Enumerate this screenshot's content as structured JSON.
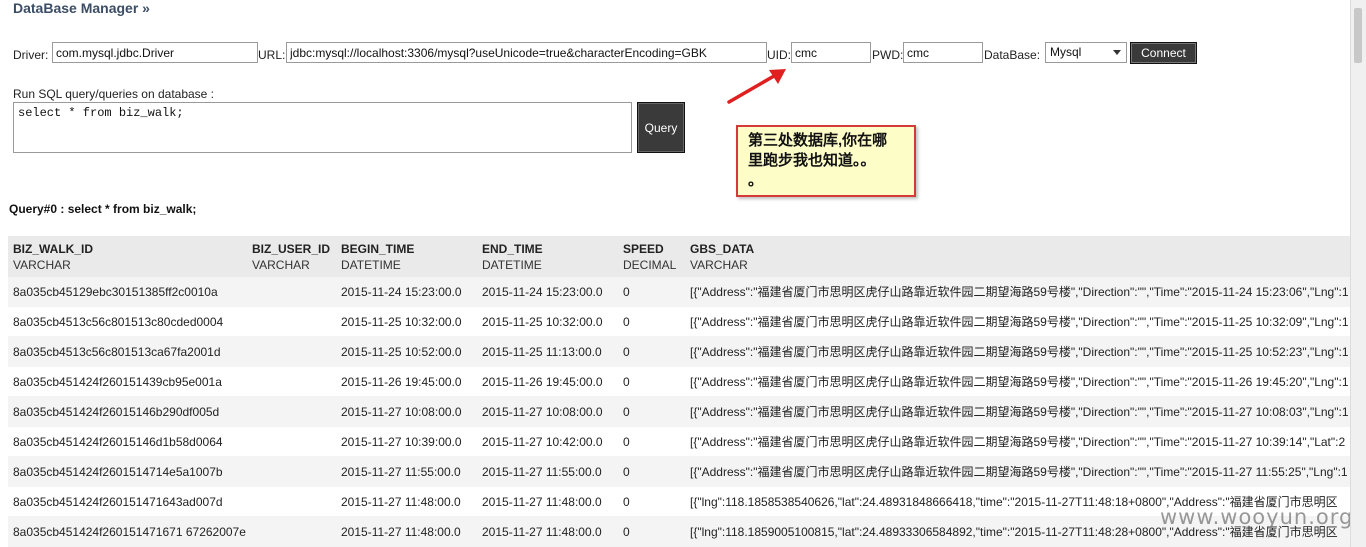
{
  "app": {
    "title": "DataBase Manager »"
  },
  "connection": {
    "driver_label": "Driver:",
    "driver_value": "com.mysql.jdbc.Driver",
    "url_label": "URL:",
    "url_value": "jdbc:mysql://localhost:3306/mysql?useUnicode=true&characterEncoding=GBK",
    "uid_label": "UID:",
    "uid_value": "cmc",
    "pwd_label": "PWD:",
    "pwd_value": "cmc",
    "database_label": "DataBase:",
    "database_value": "Mysql",
    "connect_label": "Connect"
  },
  "query": {
    "prompt": "Run SQL query/queries on database :",
    "sql": "select * from biz_walk;",
    "button_label": "Query",
    "result_title": "Query#0 : select * from biz_walk;"
  },
  "annotation": {
    "line1": "第三处数据库,你在哪",
    "line2": "里跑步我也知道。。",
    "line3": "。",
    "border_color": "#d43a3a",
    "arrow_color": "#e02020"
  },
  "table": {
    "columns": [
      {
        "name": "BIZ_WALK_ID",
        "type": "VARCHAR"
      },
      {
        "name": "BIZ_USER_ID",
        "type": "VARCHAR"
      },
      {
        "name": "BEGIN_TIME",
        "type": "DATETIME"
      },
      {
        "name": "END_TIME",
        "type": "DATETIME"
      },
      {
        "name": "SPEED",
        "type": "DECIMAL"
      },
      {
        "name": "GBS_DATA",
        "type": "VARCHAR"
      }
    ],
    "rows": [
      [
        "8a035cb45129ebc30151385ff2c0010a",
        "",
        "2015-11-24 15:23:00.0",
        "2015-11-24 15:23:00.0",
        "0",
        "[{\"Address\":\"福建省厦门市思明区虎仔山路靠近软件园二期望海路59号楼\",\"Direction\":\"\",\"Time\":\"2015-11-24 15:23:06\",\"Lng\":1"
      ],
      [
        "8a035cb4513c56c801513c80cded0004",
        "",
        "2015-11-25 10:32:00.0",
        "2015-11-25 10:32:00.0",
        "0",
        "[{\"Address\":\"福建省厦门市思明区虎仔山路靠近软件园二期望海路59号楼\",\"Direction\":\"\",\"Time\":\"2015-11-25 10:32:09\",\"Lng\":1"
      ],
      [
        "8a035cb4513c56c801513ca67fa2001d",
        "",
        "2015-11-25 10:52:00.0",
        "2015-11-25 11:13:00.0",
        "0",
        "[{\"Address\":\"福建省厦门市思明区虎仔山路靠近软件园二期望海路59号楼\",\"Direction\":\"\",\"Time\":\"2015-11-25 10:52:23\",\"Lng\":1"
      ],
      [
        "8a035cb451424f260151439cb95e001a",
        "",
        "2015-11-26 19:45:00.0",
        "2015-11-26 19:45:00.0",
        "0",
        "[{\"Address\":\"福建省厦门市思明区虎仔山路靠近软件园二期望海路59号楼\",\"Direction\":\"\",\"Time\":\"2015-11-26 19:45:20\",\"Lng\":1"
      ],
      [
        "8a035cb451424f26015146b290df005d",
        "",
        "2015-11-27 10:08:00.0",
        "2015-11-27 10:08:00.0",
        "0",
        "[{\"Address\":\"福建省厦门市思明区虎仔山路靠近软件园二期望海路59号楼\",\"Direction\":\"\",\"Time\":\"2015-11-27 10:08:03\",\"Lng\":1"
      ],
      [
        "8a035cb451424f26015146d1b58d0064",
        "",
        "2015-11-27 10:39:00.0",
        "2015-11-27 10:42:00.0",
        "0",
        "[{\"Address\":\"福建省厦门市思明区虎仔山路靠近软件园二期望海路59号楼\",\"Direction\":\"\",\"Time\":\"2015-11-27 10:39:14\",\"Lat\":2"
      ],
      [
        "8a035cb451424f2601514714e5a1007b",
        "",
        "2015-11-27 11:55:00.0",
        "2015-11-27 11:55:00.0",
        "0",
        "[{\"Address\":\"福建省厦门市思明区虎仔山路靠近软件园二期望海路59号楼\",\"Direction\":\"\",\"Time\":\"2015-11-27 11:55:25\",\"Lng\":1"
      ],
      [
        "8a035cb451424f260151471643ad007d",
        "",
        "2015-11-27 11:48:00.0",
        "2015-11-27 11:48:00.0",
        "0",
        "[{\"lng\":118.1858538540626,\"lat\":24.48931848666418,\"time\":\"2015-11-27T11:48:18+0800\",\"Address\":\"福建省厦门市思明区"
      ],
      [
        "8a035cb451424f260151471671 67262007e",
        "",
        "2015-11-27 11:48:00.0",
        "2015-11-27 11:48:00.0",
        "0",
        "[{\"lng\":118.1859005100815,\"lat\":24.48933306584892,\"time\":\"2015-11-27T11:48:28+0800\",\"Address\":\"福建省厦门市思明区"
      ]
    ]
  },
  "watermark": "www.wooyun.org"
}
